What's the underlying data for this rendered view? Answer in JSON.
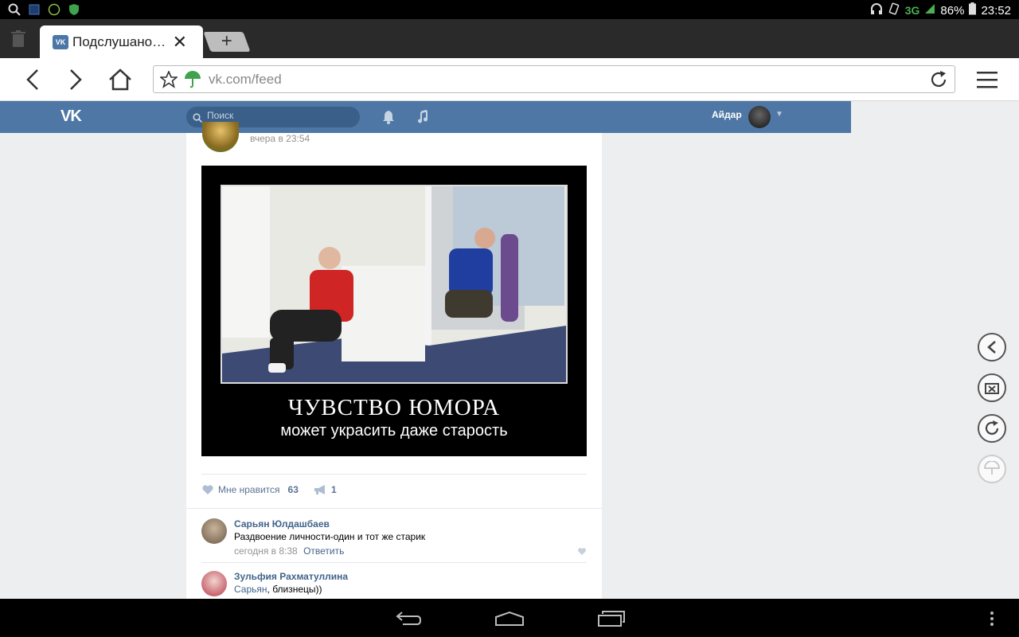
{
  "status_bar": {
    "network": "3G",
    "battery": "86%",
    "time": "23:52"
  },
  "browser": {
    "tab_title": "Подслушано…",
    "tab_close_label": "✕",
    "new_tab_label": "+",
    "url": "vk.com/feed"
  },
  "vk_header": {
    "logo": "VK",
    "search_placeholder": "Поиск",
    "user_name": "Айдар"
  },
  "post": {
    "date": "вчера в 23:54",
    "image_title": "ЧУВСТВО ЮМОРА",
    "image_subtitle": "может украсить даже старость",
    "like_label": "Мне нравится",
    "like_count": "63",
    "share_count": "1"
  },
  "comments": [
    {
      "author": "Сарьян Юлдашбаев",
      "text": "Раздвоение личности-один и тот же старик",
      "time": "сегодня в 8:38",
      "reply_label": "Ответить"
    },
    {
      "author": "Зульфия Рахматуллина",
      "mention": "Сарьян",
      "text": ", близнецы))"
    }
  ],
  "colors": {
    "vk_blue": "#4e77a5",
    "link": "#42648b",
    "page_bg": "#edeef0"
  }
}
